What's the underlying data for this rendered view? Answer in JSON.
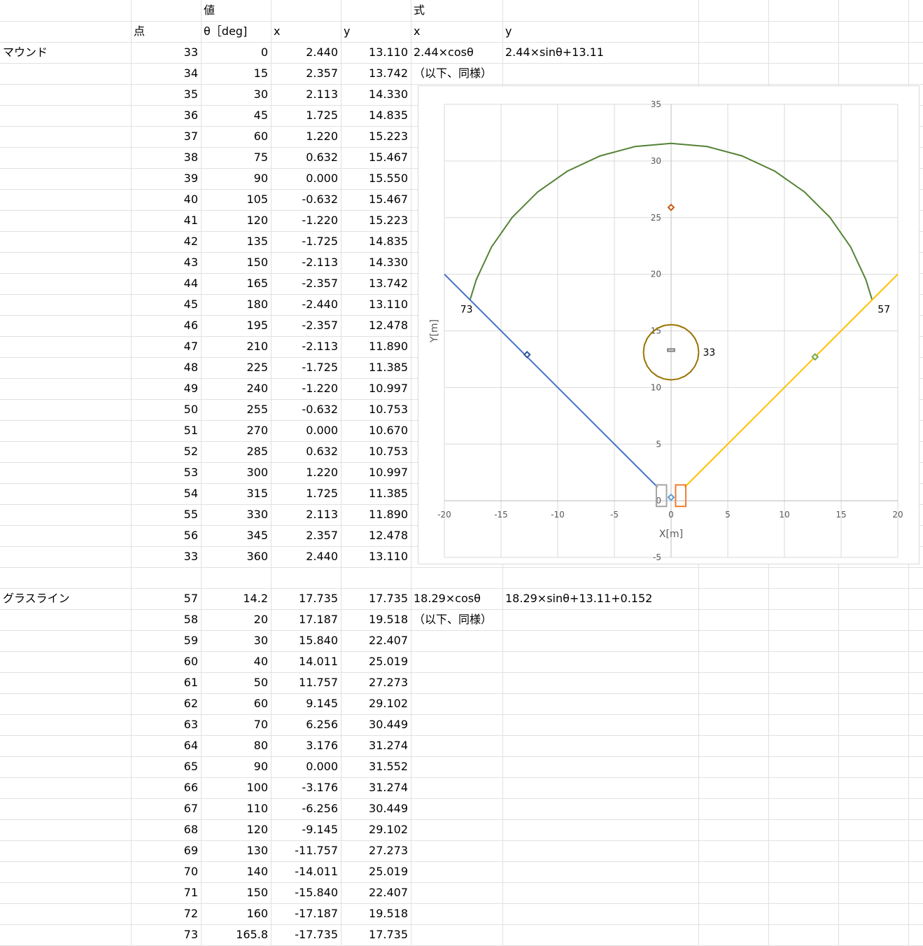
{
  "sheet": {
    "header_row1": {
      "value_group": "値",
      "formula_group": "式"
    },
    "header_row2": {
      "point": "点",
      "theta": "θ［deg]",
      "x": "x",
      "y": "y",
      "fx": "x",
      "fy": "y"
    },
    "mound": {
      "label": "マウンド",
      "formula_x": "2.44×cosθ",
      "formula_y": "2.44×sinθ+13.11",
      "note": "（以下、同様）",
      "rows": [
        [
          "33",
          "0",
          "2.440",
          "13.110"
        ],
        [
          "34",
          "15",
          "2.357",
          "13.742"
        ],
        [
          "35",
          "30",
          "2.113",
          "14.330"
        ],
        [
          "36",
          "45",
          "1.725",
          "14.835"
        ],
        [
          "37",
          "60",
          "1.220",
          "15.223"
        ],
        [
          "38",
          "75",
          "0.632",
          "15.467"
        ],
        [
          "39",
          "90",
          "0.000",
          "15.550"
        ],
        [
          "40",
          "105",
          "-0.632",
          "15.467"
        ],
        [
          "41",
          "120",
          "-1.220",
          "15.223"
        ],
        [
          "42",
          "135",
          "-1.725",
          "14.835"
        ],
        [
          "43",
          "150",
          "-2.113",
          "14.330"
        ],
        [
          "44",
          "165",
          "-2.357",
          "13.742"
        ],
        [
          "45",
          "180",
          "-2.440",
          "13.110"
        ],
        [
          "46",
          "195",
          "-2.357",
          "12.478"
        ],
        [
          "47",
          "210",
          "-2.113",
          "11.890"
        ],
        [
          "48",
          "225",
          "-1.725",
          "11.385"
        ],
        [
          "49",
          "240",
          "-1.220",
          "10.997"
        ],
        [
          "50",
          "255",
          "-0.632",
          "10.753"
        ],
        [
          "51",
          "270",
          "0.000",
          "10.670"
        ],
        [
          "52",
          "285",
          "0.632",
          "10.753"
        ],
        [
          "53",
          "300",
          "1.220",
          "10.997"
        ],
        [
          "54",
          "315",
          "1.725",
          "11.385"
        ],
        [
          "55",
          "330",
          "2.113",
          "11.890"
        ],
        [
          "56",
          "345",
          "2.357",
          "12.478"
        ],
        [
          "33",
          "360",
          "2.440",
          "13.110"
        ]
      ]
    },
    "grass": {
      "label": "グラスライン",
      "formula_x": "18.29×cosθ",
      "formula_y": "18.29×sinθ+13.11+0.152",
      "note": "（以下、同様）",
      "rows": [
        [
          "57",
          "14.2",
          "17.735",
          "17.735"
        ],
        [
          "58",
          "20",
          "17.187",
          "19.518"
        ],
        [
          "59",
          "30",
          "15.840",
          "22.407"
        ],
        [
          "60",
          "40",
          "14.011",
          "25.019"
        ],
        [
          "61",
          "50",
          "11.757",
          "27.273"
        ],
        [
          "62",
          "60",
          "9.145",
          "29.102"
        ],
        [
          "63",
          "70",
          "6.256",
          "30.449"
        ],
        [
          "64",
          "80",
          "3.176",
          "31.274"
        ],
        [
          "65",
          "90",
          "0.000",
          "31.552"
        ],
        [
          "66",
          "100",
          "-3.176",
          "31.274"
        ],
        [
          "67",
          "110",
          "-6.256",
          "30.449"
        ],
        [
          "68",
          "120",
          "-9.145",
          "29.102"
        ],
        [
          "69",
          "130",
          "-11.757",
          "27.273"
        ],
        [
          "70",
          "140",
          "-14.011",
          "25.019"
        ],
        [
          "71",
          "150",
          "-15.840",
          "22.407"
        ],
        [
          "72",
          "160",
          "-17.187",
          "19.518"
        ],
        [
          "73",
          "165.8",
          "-17.735",
          "17.735"
        ]
      ]
    }
  },
  "chart_data": {
    "type": "scatter",
    "xlabel": "X[m]",
    "ylabel": "Y[m]",
    "xlim": [
      -20,
      20
    ],
    "ylim": [
      -5,
      35
    ],
    "x_ticks": [
      "-20",
      "-15",
      "-10",
      "-5",
      "0",
      "5",
      "10",
      "15",
      "20"
    ],
    "y_ticks": [
      "-5",
      "0",
      "5",
      "10",
      "15",
      "20",
      "25",
      "30",
      "35"
    ],
    "grid": true,
    "point_labels": [
      {
        "text": "73",
        "x": -17.735,
        "y": 17.735
      },
      {
        "text": "57",
        "x": 17.735,
        "y": 17.735
      },
      {
        "text": "33",
        "x": 2.44,
        "y": 13.11
      }
    ],
    "series": [
      {
        "color": "#548235",
        "style": "line",
        "points": [
          [
            17.735,
            17.735
          ],
          [
            17.187,
            19.518
          ],
          [
            15.84,
            22.407
          ],
          [
            14.011,
            25.019
          ],
          [
            11.757,
            27.273
          ],
          [
            9.145,
            29.102
          ],
          [
            6.256,
            30.449
          ],
          [
            3.176,
            31.274
          ],
          [
            0.0,
            31.552
          ],
          [
            -3.176,
            31.274
          ],
          [
            -6.256,
            30.449
          ],
          [
            -9.145,
            29.102
          ],
          [
            -11.757,
            27.273
          ],
          [
            -14.011,
            25.019
          ],
          [
            -15.84,
            22.407
          ],
          [
            -17.187,
            19.518
          ],
          [
            -17.735,
            17.735
          ]
        ]
      },
      {
        "color": "#997300",
        "style": "line",
        "points": [
          [
            2.44,
            13.11
          ],
          [
            2.357,
            13.742
          ],
          [
            2.113,
            14.33
          ],
          [
            1.725,
            14.835
          ],
          [
            1.22,
            15.223
          ],
          [
            0.632,
            15.467
          ],
          [
            0.0,
            15.55
          ],
          [
            -0.632,
            15.467
          ],
          [
            -1.22,
            15.223
          ],
          [
            -1.725,
            14.835
          ],
          [
            -2.113,
            14.33
          ],
          [
            -2.357,
            13.742
          ],
          [
            -2.44,
            13.11
          ],
          [
            -2.357,
            12.478
          ],
          [
            -2.113,
            11.89
          ],
          [
            -1.725,
            11.385
          ],
          [
            -1.22,
            10.997
          ],
          [
            -0.632,
            10.753
          ],
          [
            0.0,
            10.67
          ],
          [
            0.632,
            10.753
          ],
          [
            1.22,
            10.997
          ],
          [
            1.725,
            11.385
          ],
          [
            2.113,
            11.89
          ],
          [
            2.357,
            12.478
          ],
          [
            2.44,
            13.11
          ]
        ]
      },
      {
        "color": "#4472c4",
        "style": "line",
        "points": [
          [
            -20,
            20
          ],
          [
            -1.2,
            1.2
          ]
        ]
      },
      {
        "color": "#ffc000",
        "style": "line",
        "points": [
          [
            20,
            20
          ],
          [
            1.2,
            1.2
          ]
        ]
      },
      {
        "color": "#a5a5a5",
        "style": "rect",
        "points": [
          [
            -1.3,
            -0.5
          ],
          [
            -0.4,
            1.4
          ]
        ]
      },
      {
        "color": "#ed7d31",
        "style": "rect",
        "points": [
          [
            0.4,
            -0.5
          ],
          [
            1.3,
            1.4
          ]
        ]
      },
      {
        "color": "#808080",
        "style": "rect",
        "points": [
          [
            -0.3,
            13.2
          ],
          [
            0.3,
            13.4
          ]
        ]
      },
      {
        "color": "#c55a11",
        "style": "marker",
        "points": [
          [
            0,
            25.9
          ]
        ]
      },
      {
        "color": "#2f5597",
        "style": "marker",
        "points": [
          [
            -12.7,
            12.9
          ]
        ]
      },
      {
        "color": "#70ad47",
        "style": "marker",
        "points": [
          [
            12.7,
            12.7
          ]
        ]
      },
      {
        "color": "#5b9bd5",
        "style": "marker",
        "points": [
          [
            0,
            0.3
          ]
        ]
      }
    ]
  }
}
